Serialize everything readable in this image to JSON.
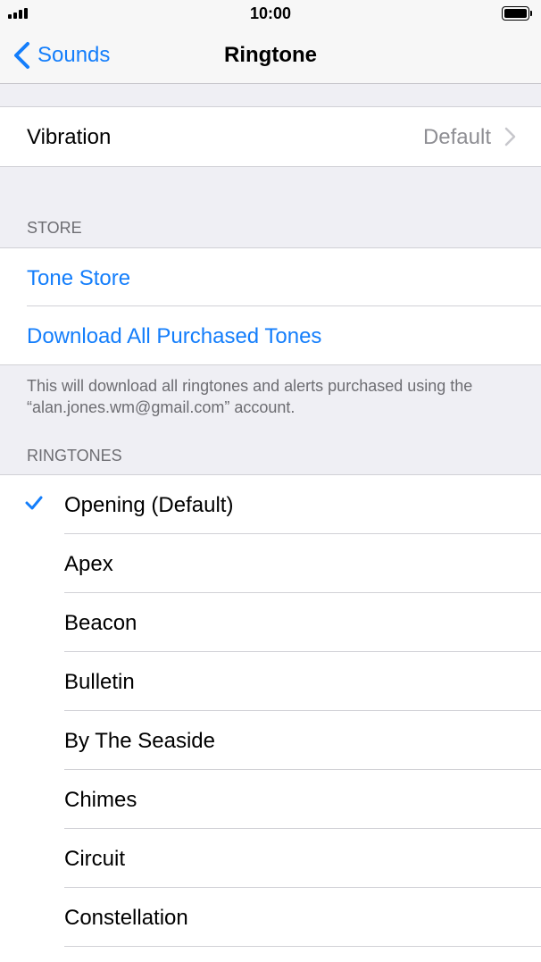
{
  "status_bar": {
    "time": "10:00"
  },
  "nav": {
    "back_label": "Sounds",
    "title": "Ringtone"
  },
  "vibration": {
    "label": "Vibration",
    "value": "Default"
  },
  "store": {
    "header": "STORE",
    "items": [
      "Tone Store",
      "Download All Purchased Tones"
    ],
    "footer": "This will download all ringtones and alerts purchased using the “alan.jones.wm@gmail.com” account."
  },
  "ringtones": {
    "header": "RINGTONES",
    "selected_index": 0,
    "items": [
      "Opening (Default)",
      "Apex",
      "Beacon",
      "Bulletin",
      "By The Seaside",
      "Chimes",
      "Circuit",
      "Constellation"
    ]
  },
  "colors": {
    "accent": "#147efb",
    "background": "#efeff4",
    "secondary_text": "#6d6d72",
    "value_text": "#8e8e93"
  }
}
